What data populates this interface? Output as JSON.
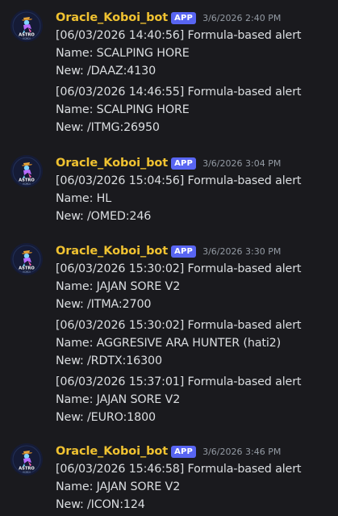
{
  "messages": [
    {
      "username": "Oracle_Koboi_bot",
      "badge": "APP",
      "timestamp": "3/6/2026 2:40 PM",
      "avatar_text": "ASTRO",
      "avatar_subtext": "KOBOI",
      "alerts": [
        {
          "line1": "[06/03/2026 14:40:56] Formula-based alert",
          "line2": "Name: SCALPING HORE",
          "line3": "New: /DAAZ:4130"
        },
        {
          "line1": "[06/03/2026 14:46:55] Formula-based alert",
          "line2": "Name: SCALPING HORE",
          "line3": "New: /ITMG:26950"
        }
      ]
    },
    {
      "username": "Oracle_Koboi_bot",
      "badge": "APP",
      "timestamp": "3/6/2026 3:04 PM",
      "avatar_text": "ASTRO",
      "avatar_subtext": "KOBOI",
      "alerts": [
        {
          "line1": "[06/03/2026 15:04:56] Formula-based alert",
          "line2": "Name: HL",
          "line3": "New: /OMED:246"
        }
      ]
    },
    {
      "username": "Oracle_Koboi_bot",
      "badge": "APP",
      "timestamp": "3/6/2026 3:30 PM",
      "avatar_text": "ASTRO",
      "avatar_subtext": "KOBOI",
      "alerts": [
        {
          "line1": "[06/03/2026 15:30:02] Formula-based alert",
          "line2": "Name: JAJAN SORE V2",
          "line3": "New: /ITMA:2700"
        },
        {
          "line1": "[06/03/2026 15:30:02] Formula-based alert",
          "line2": "Name: AGGRESIVE ARA HUNTER (hati2)",
          "line3": "New: /RDTX:16300"
        },
        {
          "line1": "[06/03/2026 15:37:01] Formula-based alert",
          "line2": "Name: JAJAN SORE V2",
          "line3": "New: /EURO:1800"
        }
      ]
    },
    {
      "username": "Oracle_Koboi_bot",
      "badge": "APP",
      "timestamp": "3/6/2026 3:46 PM",
      "avatar_text": "ASTRO",
      "avatar_subtext": "KOBOI",
      "alerts": [
        {
          "line1": "[06/03/2026 15:46:58] Formula-based alert",
          "line2": "Name: JAJAN SORE V2",
          "line3": "New: /ICON:124"
        }
      ]
    }
  ],
  "colors": {
    "background": "#1a1a1e",
    "username": "#f0c231",
    "badge": "#5865f2",
    "text": "#dbdee1",
    "timestamp": "#949ba4"
  }
}
